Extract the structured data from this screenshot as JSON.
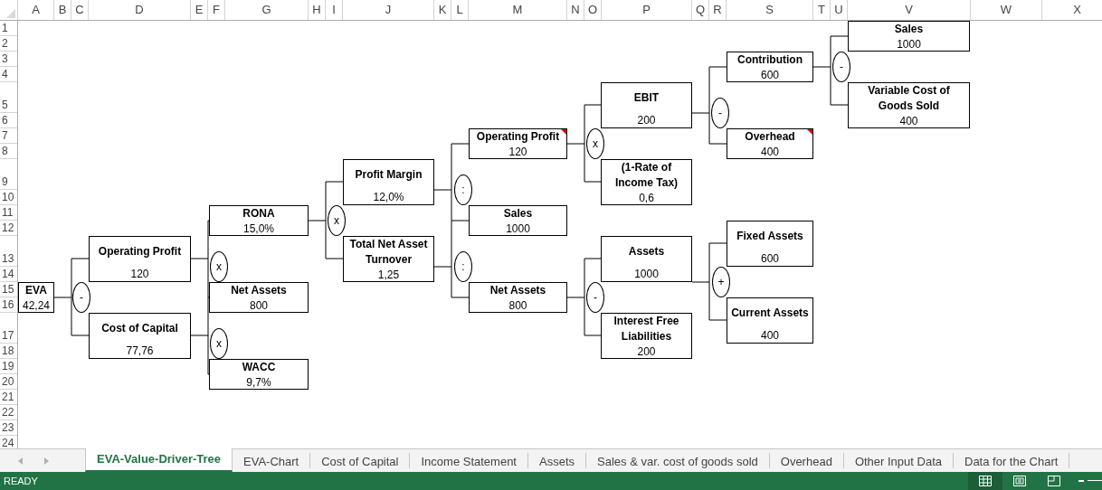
{
  "columns": [
    "A",
    "B",
    "C",
    "D",
    "E",
    "F",
    "G",
    "H",
    "I",
    "J",
    "K",
    "L",
    "M",
    "N",
    "O",
    "P",
    "Q",
    "R",
    "S",
    "T",
    "U",
    "V",
    "W",
    "X"
  ],
  "rows": [
    "1",
    "2",
    "3",
    "4",
    "5",
    "6",
    "7",
    "8",
    "9",
    "10",
    "11",
    "12",
    "13",
    "14",
    "15",
    "16",
    "17",
    "18",
    "19",
    "20",
    "21",
    "22",
    "23",
    "24"
  ],
  "nodes": [
    {
      "label": "Sales",
      "value": "1000",
      "comment": false
    },
    {
      "label": "Contribution",
      "value": "600",
      "comment": false
    },
    {
      "label": "EBIT",
      "value": "200",
      "comment": false
    },
    {
      "label": "Variable Cost of Goods Sold",
      "value": "400",
      "comment": false
    },
    {
      "label": "Operating Profit",
      "value": "120",
      "comment": true
    },
    {
      "label": "Overhead",
      "value": "400",
      "comment": true
    },
    {
      "label": "Profit Margin",
      "value": "12,0%",
      "comment": false
    },
    {
      "label": "(1-Rate of Income Tax)",
      "value": "0,6",
      "comment": false
    },
    {
      "label": "RONA",
      "value": "15,0%",
      "comment": false
    },
    {
      "label": "Sales",
      "value": "1000",
      "comment": false
    },
    {
      "label": "Fixed Assets",
      "value": "600",
      "comment": false
    },
    {
      "label": "Operating Profit",
      "value": "120",
      "comment": false
    },
    {
      "label": "Total Net Asset Turnover",
      "value": "1,25",
      "comment": false
    },
    {
      "label": "Assets",
      "value": "1000",
      "comment": false
    },
    {
      "label": "EVA",
      "value": "42,24",
      "comment": false
    },
    {
      "label": "Net Assets",
      "value": "800",
      "comment": false
    },
    {
      "label": "Net Assets",
      "value": "800",
      "comment": false
    },
    {
      "label": "Current Assets",
      "value": "400",
      "comment": false
    },
    {
      "label": "Cost of Capital",
      "value": "77,76",
      "comment": false
    },
    {
      "label": "Interest Free Liabilities",
      "value": "200",
      "comment": false
    },
    {
      "label": "WACC",
      "value": "9,7%",
      "comment": false
    }
  ],
  "operators": [
    "-",
    "-",
    "x",
    ":",
    "x",
    "x",
    ":",
    "+",
    "-",
    "-",
    "x"
  ],
  "sheet_tabs": [
    {
      "label": "EVA-Value-Driver-Tree",
      "selected": true
    },
    {
      "label": "EVA-Chart",
      "selected": false
    },
    {
      "label": "Cost of Capital",
      "selected": false
    },
    {
      "label": "Income Statement",
      "selected": false
    },
    {
      "label": "Assets",
      "selected": false
    },
    {
      "label": "Sales & var. cost of goods sold",
      "selected": false
    },
    {
      "label": "Overhead",
      "selected": false
    },
    {
      "label": "Other Input Data",
      "selected": false
    },
    {
      "label": "Data for the Chart",
      "selected": false
    }
  ],
  "status_bar": {
    "mode": "READY"
  }
}
